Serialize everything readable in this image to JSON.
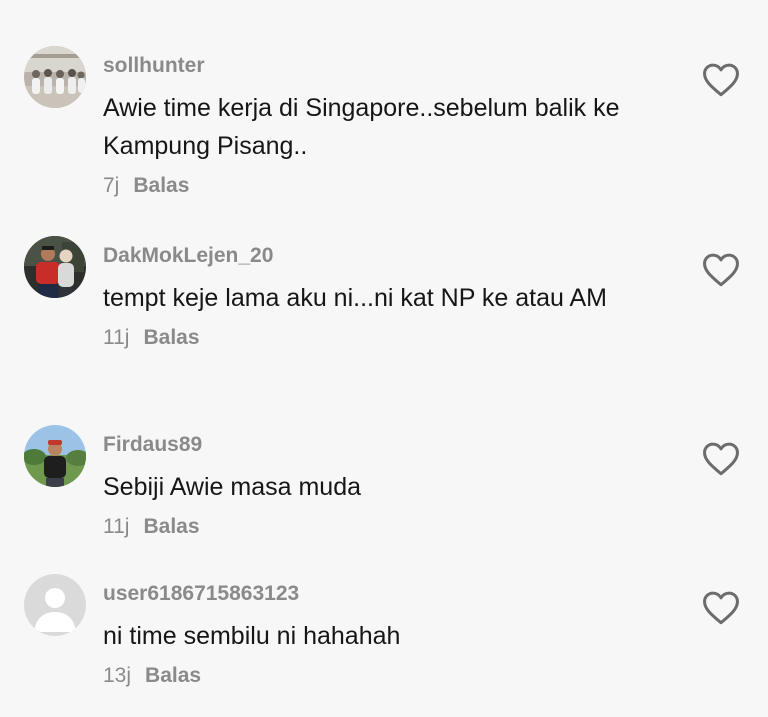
{
  "comments": [
    {
      "username": "sollhunter",
      "text": "Awie time kerja di Singapore..sebelum balik ke Kampung Pisang..",
      "time": "7j",
      "reply_label": "Balas",
      "avatar": "group-photo-avatar",
      "like_icon": "heart-outline-icon"
    },
    {
      "username": "DakMokLejen_20",
      "text": "tempt keje lama aku ni...ni kat NP ke atau AM",
      "time": "11j",
      "reply_label": "Balas",
      "avatar": "couple-photo-avatar",
      "like_icon": "heart-outline-icon"
    },
    {
      "username": "Firdaus89",
      "text": "Sebiji Awie masa muda",
      "time": "11j",
      "reply_label": "Balas",
      "avatar": "outdoor-photo-avatar",
      "like_icon": "heart-outline-icon"
    },
    {
      "username": "user6186715863123",
      "text": "ni time sembilu ni hahahah",
      "time": "13j",
      "reply_label": "Balas",
      "avatar": "default-user-avatar",
      "like_icon": "heart-outline-icon"
    }
  ],
  "colors": {
    "background": "#f7f7f7",
    "text_primary": "#161616",
    "text_secondary": "#8a8a8a"
  }
}
